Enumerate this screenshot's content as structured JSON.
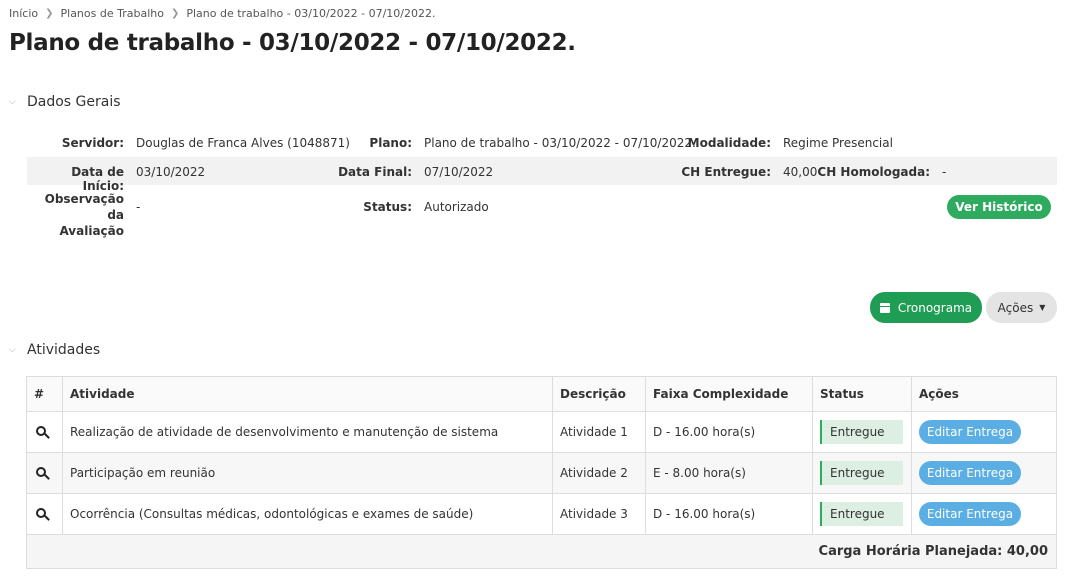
{
  "breadcrumb": [
    "Início",
    "Planos de Trabalho",
    "Plano de trabalho - 03/10/2022 - 07/10/2022."
  ],
  "page_title": "Plano de trabalho - 03/10/2022 - 07/10/2022.",
  "dados_gerais": {
    "title": "Dados Gerais",
    "servidor_label": "Servidor:",
    "servidor_value": "Douglas de Franca Alves (1048871)",
    "plano_label": "Plano:",
    "plano_value": "Plano de trabalho - 03/10/2022 - 07/10/2022.",
    "modalidade_label": "Modalidade:",
    "modalidade_value": "Regime Presencial",
    "data_inicio_label": "Data de Início:",
    "data_inicio_value": "03/10/2022",
    "data_final_label": "Data Final:",
    "data_final_value": "07/10/2022",
    "ch_entregue_label": "CH Entregue:",
    "ch_entregue_value": "40,00",
    "ch_homologada_label": "CH Homologada:",
    "ch_homologada_value": "-",
    "observacao_label_1": "Observação da",
    "observacao_label_2": "Avaliação",
    "observacao_value": "-",
    "status_label": "Status:",
    "status_value": "Autorizado",
    "ver_historico_label": "Ver Histórico"
  },
  "toolbar": {
    "cronograma_label": "Cronograma",
    "acoes_label": "Ações"
  },
  "atividades": {
    "title": "Atividades",
    "columns": {
      "index": "#",
      "atividade": "Atividade",
      "descricao": "Descrição",
      "faixa": "Faixa Complexidade",
      "status": "Status",
      "acoes": "Ações"
    },
    "rows": [
      {
        "atividade": "Realização de atividade de desenvolvimento e manutenção de sistema",
        "descricao": "Atividade 1",
        "faixa": "D - 16.00 hora(s)",
        "status": "Entregue",
        "acao": "Editar Entrega"
      },
      {
        "atividade": "Participação em reunião",
        "descricao": "Atividade 2",
        "faixa": "E - 8.00 hora(s)",
        "status": "Entregue",
        "acao": "Editar Entrega"
      },
      {
        "atividade": "Ocorrência (Consultas médicas, odontológicas e exames de saúde)",
        "descricao": "Atividade 3",
        "faixa": "D - 16.00 hora(s)",
        "status": "Entregue",
        "acao": "Editar Entrega"
      }
    ],
    "footer": "Carga Horária Planejada: 40,00"
  },
  "colors": {
    "primary_green": "#1f9d55",
    "badge_green": "#2eab5e",
    "info_blue": "#5aaee3"
  }
}
